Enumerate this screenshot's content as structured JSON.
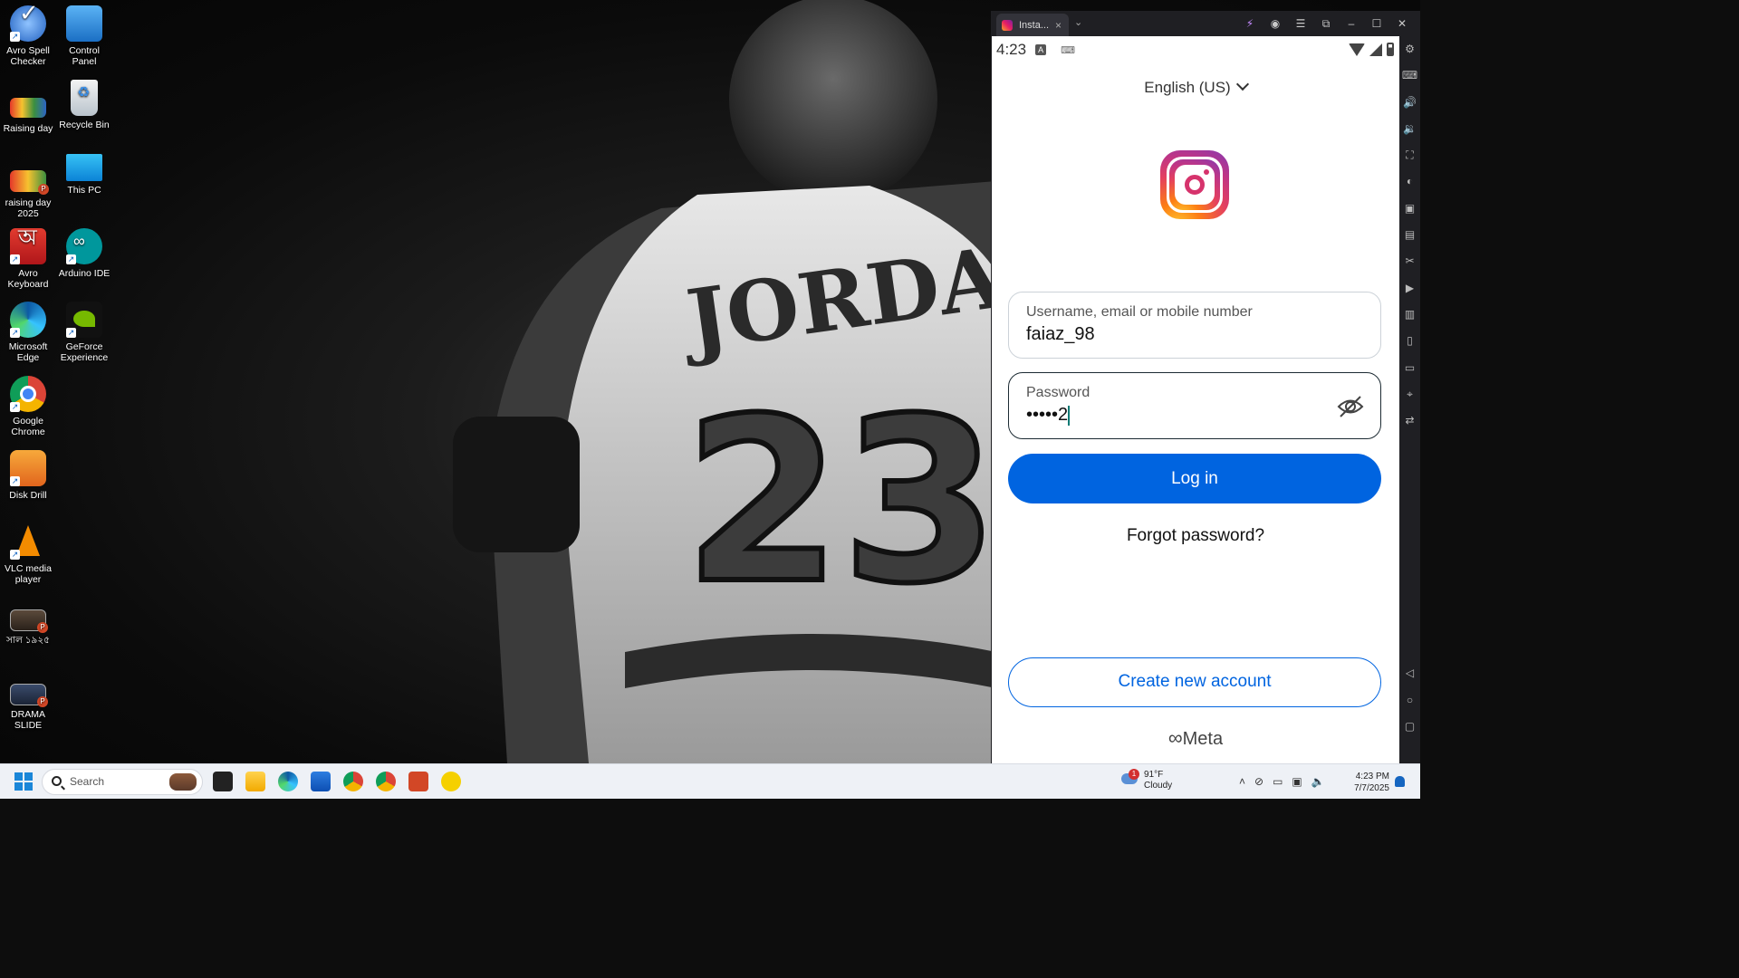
{
  "desktop": {
    "icons": [
      {
        "label": "Avro Spell Checker",
        "icon": "avro-spell-icon"
      },
      {
        "label": "Control Panel",
        "icon": "control-panel-icon"
      },
      {
        "label": "Raising day",
        "icon": "image-file-icon"
      },
      {
        "label": "Recycle Bin",
        "icon": "recycle-bin-icon"
      },
      {
        "label": "raising day 2025",
        "icon": "powerpoint-file-icon"
      },
      {
        "label": "This PC",
        "icon": "monitor-icon"
      },
      {
        "label": "Avro Keyboard",
        "icon": "avro-keyboard-icon"
      },
      {
        "label": "Arduino IDE",
        "icon": "arduino-icon"
      },
      {
        "label": "Microsoft Edge",
        "icon": "edge-icon"
      },
      {
        "label": "GeForce Experience",
        "icon": "nvidia-icon"
      },
      {
        "label": "Google Chrome",
        "icon": "chrome-icon"
      },
      {
        "label": "Disk Drill",
        "icon": "disk-drill-icon"
      },
      {
        "label": "VLC media player",
        "icon": "vlc-icon"
      },
      {
        "label": "সাল ১৯২৫",
        "icon": "powerpoint-file-icon"
      },
      {
        "label": "DRAMA SLIDE",
        "icon": "powerpoint-file-icon"
      }
    ]
  },
  "emulator": {
    "tab_title": "Insta...",
    "tab_close": "×",
    "tab_dropdown": "⌄"
  },
  "phone": {
    "status": {
      "time": "4:23",
      "a_icon": "A"
    },
    "language": "English (US)",
    "username_field": {
      "label": "Username, email or mobile number",
      "value": "faiaz_98"
    },
    "password_field": {
      "label": "Password",
      "value": "•••••2"
    },
    "login_button": "Log in",
    "forgot_password": "Forgot password?",
    "create_account_button": "Create new account",
    "meta_brand": "Meta",
    "colors": {
      "primary": "#0064e0",
      "text": "#111111"
    }
  },
  "taskbar": {
    "search_placeholder": "Search",
    "weather": {
      "temp": "91°F",
      "condition": "Cloudy",
      "badge": "1"
    },
    "clock": {
      "time": "4:23 PM",
      "date": "7/7/2025"
    }
  }
}
